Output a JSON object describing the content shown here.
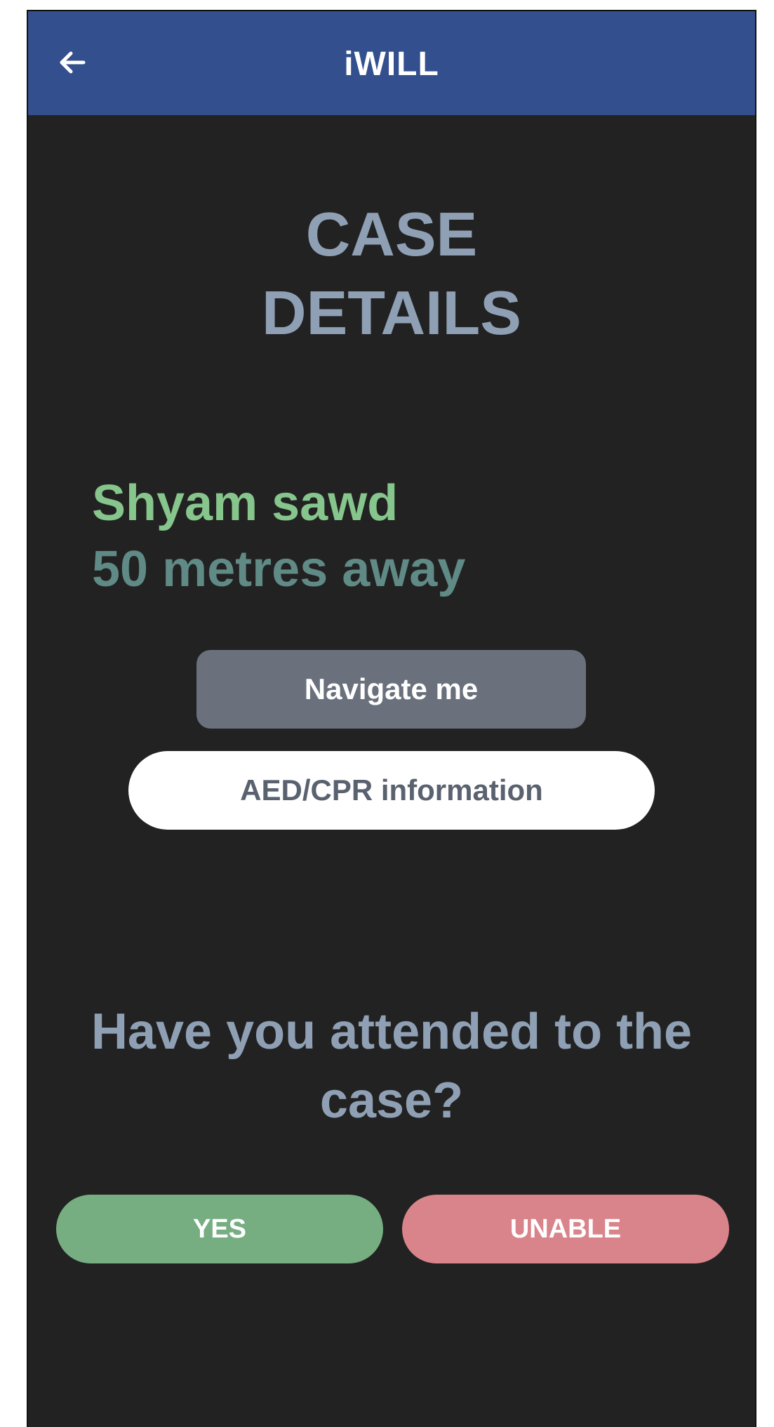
{
  "appbar": {
    "title": "iWILL",
    "back_icon": "arrow-left-icon",
    "background_color": "#334f8e"
  },
  "page": {
    "title": "CASE\nDETAILS"
  },
  "case": {
    "name": "Shyam sawd",
    "distance": "50 metres away"
  },
  "actions": {
    "navigate_label": "Navigate me",
    "aed_label": "AED/CPR information"
  },
  "question": {
    "text": "Have you attended to the case?"
  },
  "response": {
    "yes_label": "YES",
    "unable_label": "UNABLE",
    "yes_color": "#76ae82",
    "unable_color": "#d9848a"
  }
}
